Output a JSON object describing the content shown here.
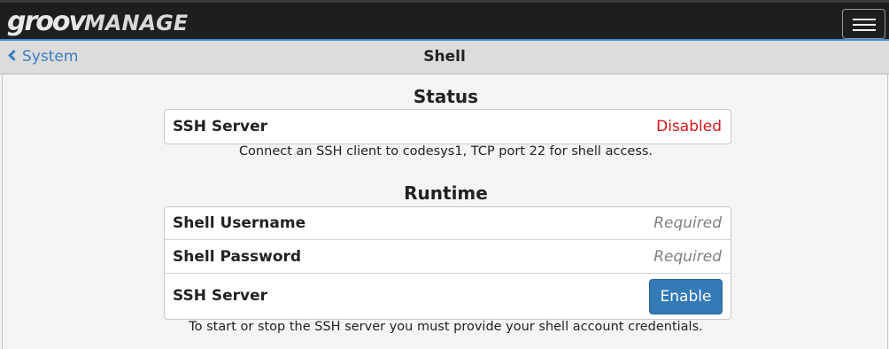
{
  "header": {
    "logo_left": "groov",
    "logo_right": "MANAGE",
    "menu_icon": "hamburger-menu-icon"
  },
  "nav": {
    "back_label": "System",
    "title": "Shell"
  },
  "status": {
    "title": "Status",
    "ssh_server_label": "SSH Server",
    "ssh_server_value": "Disabled",
    "help": "Connect an SSH client to codesys1, TCP port 22 for shell access."
  },
  "runtime": {
    "title": "Runtime",
    "username_label": "Shell Username",
    "username_placeholder": "Required",
    "password_label": "Shell Password",
    "password_placeholder": "Required",
    "ssh_server_label": "SSH Server",
    "enable_label": "Enable",
    "help": "To start or stop the SSH server you must provide your shell account credentials."
  },
  "colors": {
    "accent": "#337ab7",
    "link": "#3a7cc3",
    "disabled": "#d0161b"
  }
}
